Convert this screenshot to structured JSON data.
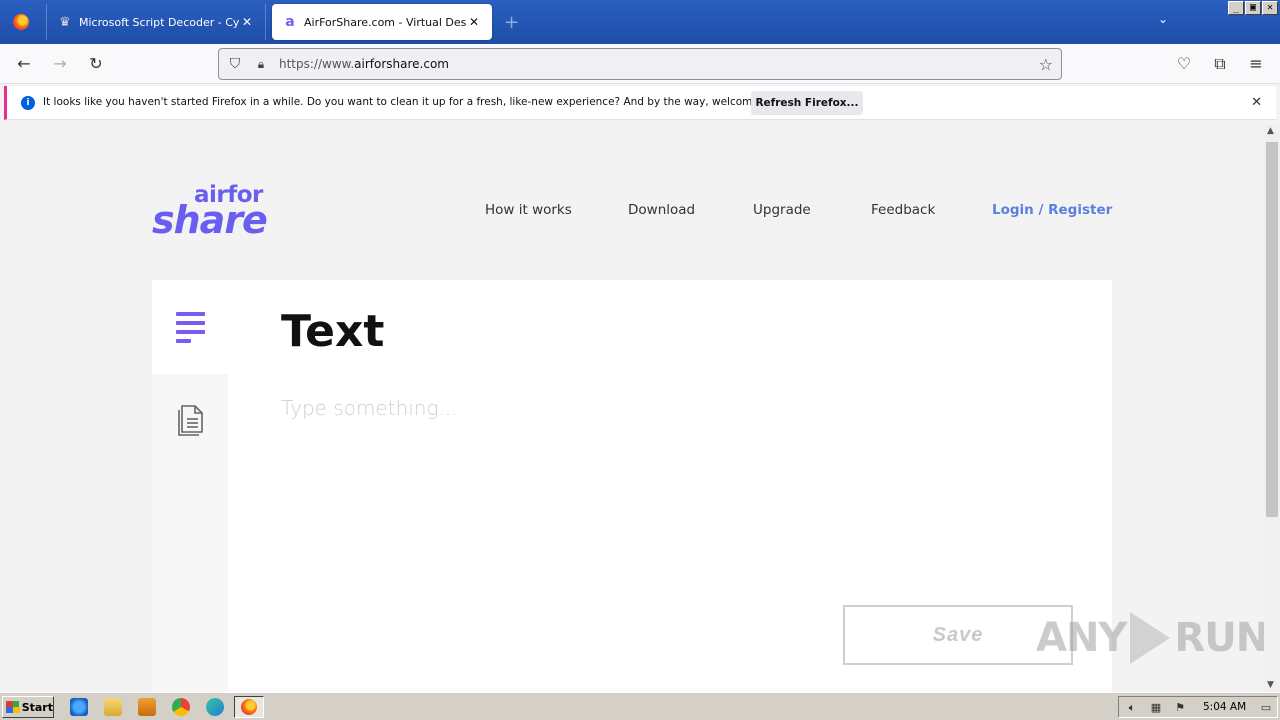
{
  "browser": {
    "tabs": [
      {
        "title": "Microsoft Script Decoder - CyberCh",
        "active": false
      },
      {
        "title": "AirForShare.com - Virtual Desktop Sh",
        "active": true
      }
    ],
    "url_prefix": "https://www.",
    "url_domain": "airforshare.com",
    "notification": {
      "message": "It looks like you haven't started Firefox in a while. Do you want to clean it up for a fresh, like-new experience? And by the way, welcome back!",
      "button": "Refresh Firefox..."
    }
  },
  "site": {
    "logo_top": "airfor",
    "logo_bottom": "share",
    "nav": [
      "How it works",
      "Download",
      "Upgrade",
      "Feedback",
      "Login / Register"
    ],
    "heading": "Text",
    "editor_placeholder": "Type something...",
    "save_label": "Save",
    "accent_color": "#6a5ef0"
  },
  "watermark": {
    "left": "ANY",
    "right": "RUN"
  },
  "taskbar": {
    "start_label": "Start",
    "clock": "5:04 AM"
  }
}
